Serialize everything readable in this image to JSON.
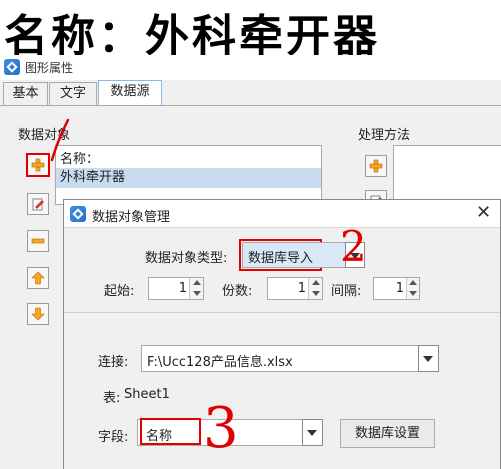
{
  "heading": "名称：外科牵开器",
  "window": {
    "title": "图形属性"
  },
  "tabs": [
    {
      "label": "基本"
    },
    {
      "label": "文字"
    },
    {
      "label": "数据源"
    }
  ],
  "data_objects": {
    "label": "数据对象",
    "items": [
      "名称：",
      "外科牵开器"
    ]
  },
  "process": {
    "label": "处理方法"
  },
  "dialog": {
    "title": "数据对象管理",
    "type_label": "数据对象类型:",
    "type_value": "数据库导入",
    "start_label": "起始:",
    "start_value": "1",
    "count_label": "份数:",
    "count_value": "1",
    "interval_label": "间隔:",
    "interval_value": "1",
    "connect_label": "连接:",
    "connect_value": "F:\\Ucc128产品信息.xlsx",
    "table_label": "表:",
    "table_value": "Sheet1",
    "field_label": "字段:",
    "field_value": "名称",
    "db_settings_button": "数据库设置"
  },
  "annotations": [
    "1",
    "2",
    "3"
  ]
}
